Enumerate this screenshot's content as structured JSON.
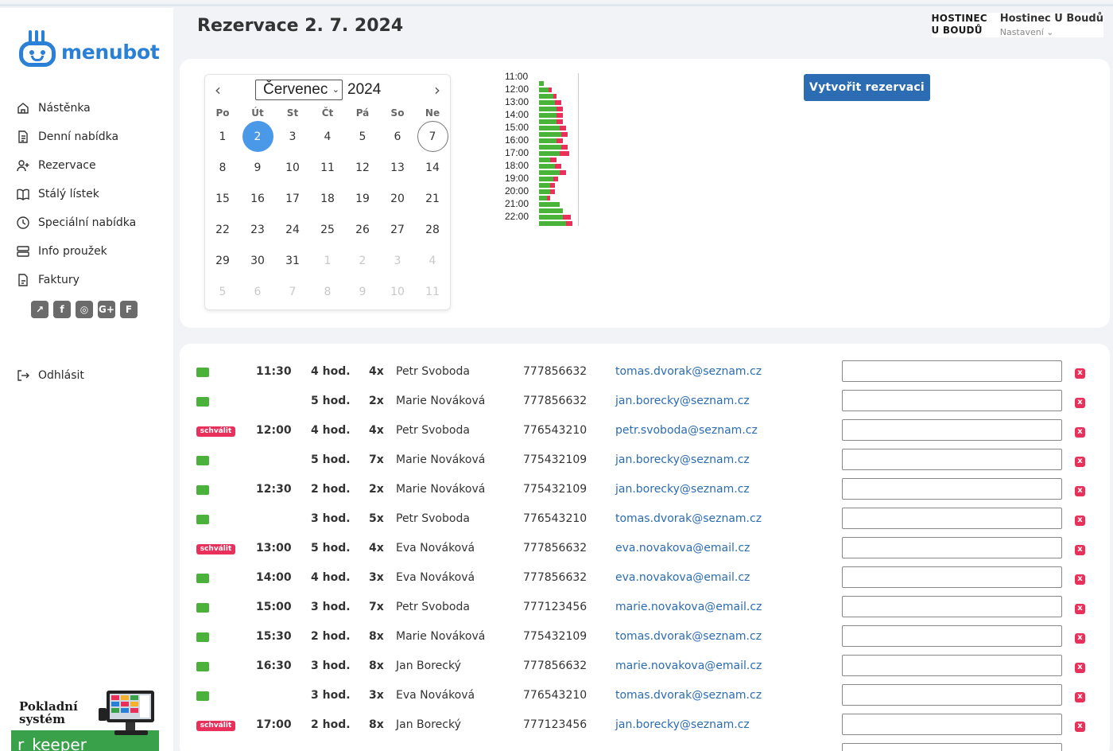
{
  "app": {
    "logo_text": "menubot"
  },
  "header": {
    "title": "Rezervace 2. 7. 2024",
    "restaurant_logo_line1": "HOSTINEC",
    "restaurant_logo_line2": "U BOUDŮ",
    "restaurant_name": "Hostinec U Boudů",
    "settings_label": "Nastavení"
  },
  "sidebar": {
    "items": [
      {
        "label": "Nástěnka",
        "icon": "home-icon"
      },
      {
        "label": "Denní nabídka",
        "icon": "document-icon"
      },
      {
        "label": "Rezervace",
        "icon": "add-user-icon"
      },
      {
        "label": "Stálý lístek",
        "icon": "book-icon"
      },
      {
        "label": "Speciální nabídka",
        "icon": "clock-icon"
      },
      {
        "label": "Info proužek",
        "icon": "strip-icon"
      },
      {
        "label": "Faktury",
        "icon": "invoice-icon"
      }
    ],
    "social": [
      {
        "icon": "external-link-icon",
        "glyph": "↗"
      },
      {
        "icon": "facebook-icon",
        "glyph": "f"
      },
      {
        "icon": "instagram-icon",
        "glyph": "◎"
      },
      {
        "icon": "google-plus-icon",
        "glyph": "G+"
      },
      {
        "icon": "foursquare-icon",
        "glyph": "F"
      }
    ],
    "logout_label": "Odhlásit",
    "promo": {
      "title_line1": "Pokladní",
      "title_line2": "systém",
      "brand": "r_keeper"
    }
  },
  "calendar": {
    "month": "Červenec",
    "year": "2024",
    "weekdays": [
      "Po",
      "Út",
      "St",
      "Čt",
      "Pá",
      "So",
      "Ne"
    ],
    "days": [
      {
        "d": "1",
        "m": false
      },
      {
        "d": "2",
        "m": false,
        "sel": true
      },
      {
        "d": "3",
        "m": false
      },
      {
        "d": "4",
        "m": false
      },
      {
        "d": "5",
        "m": false
      },
      {
        "d": "6",
        "m": false
      },
      {
        "d": "7",
        "m": false,
        "today": true
      },
      {
        "d": "8",
        "m": false
      },
      {
        "d": "9",
        "m": false
      },
      {
        "d": "10",
        "m": false
      },
      {
        "d": "11",
        "m": false
      },
      {
        "d": "12",
        "m": false
      },
      {
        "d": "13",
        "m": false
      },
      {
        "d": "14",
        "m": false
      },
      {
        "d": "15",
        "m": false
      },
      {
        "d": "16",
        "m": false
      },
      {
        "d": "17",
        "m": false
      },
      {
        "d": "18",
        "m": false
      },
      {
        "d": "19",
        "m": false
      },
      {
        "d": "20",
        "m": false
      },
      {
        "d": "21",
        "m": false
      },
      {
        "d": "22",
        "m": false
      },
      {
        "d": "23",
        "m": false
      },
      {
        "d": "24",
        "m": false
      },
      {
        "d": "25",
        "m": false
      },
      {
        "d": "26",
        "m": false
      },
      {
        "d": "27",
        "m": false
      },
      {
        "d": "28",
        "m": false
      },
      {
        "d": "29",
        "m": false
      },
      {
        "d": "30",
        "m": false
      },
      {
        "d": "31",
        "m": false
      },
      {
        "d": "1",
        "m": true
      },
      {
        "d": "2",
        "m": true
      },
      {
        "d": "3",
        "m": true
      },
      {
        "d": "4",
        "m": true
      },
      {
        "d": "5",
        "m": true
      },
      {
        "d": "6",
        "m": true
      },
      {
        "d": "7",
        "m": true
      },
      {
        "d": "8",
        "m": true
      },
      {
        "d": "9",
        "m": true
      },
      {
        "d": "10",
        "m": true
      },
      {
        "d": "11",
        "m": true
      }
    ]
  },
  "occupancy": {
    "hour_labels": [
      "11:00",
      "12:00",
      "13:00",
      "14:00",
      "15:00",
      "16:00",
      "17:00",
      "18:00",
      "19:00",
      "20:00",
      "21:00",
      "22:00"
    ],
    "slots": [
      {
        "g": 6,
        "r": 0
      },
      {
        "g": 12,
        "r": 4
      },
      {
        "g": 18,
        "r": 4
      },
      {
        "g": 20,
        "r": 8
      },
      {
        "g": 22,
        "r": 8
      },
      {
        "g": 22,
        "r": 8
      },
      {
        "g": 22,
        "r": 8
      },
      {
        "g": 26,
        "r": 8
      },
      {
        "g": 28,
        "r": 8
      },
      {
        "g": 22,
        "r": 8
      },
      {
        "g": 28,
        "r": 8
      },
      {
        "g": 26,
        "r": 12
      },
      {
        "g": 14,
        "r": 8
      },
      {
        "g": 20,
        "r": 8
      },
      {
        "g": 26,
        "r": 8
      },
      {
        "g": 18,
        "r": 6
      },
      {
        "g": 14,
        "r": 6
      },
      {
        "g": 14,
        "r": 6
      },
      {
        "g": 10,
        "r": 4
      },
      {
        "g": 26,
        "r": 0
      },
      {
        "g": 30,
        "r": 0
      },
      {
        "g": 30,
        "r": 10
      },
      {
        "g": 34,
        "r": 8
      }
    ],
    "colors": {
      "free": "#49b33a",
      "booked": "#e8305a"
    }
  },
  "actions": {
    "create_label": "Vytvořit rezervaci"
  },
  "reservations": [
    {
      "status": "ok",
      "time": "11:30",
      "duration": "4 hod.",
      "count": "4x",
      "name": "Petr Svoboda",
      "phone": "777856632",
      "email": "tomas.dvorak@seznam.cz"
    },
    {
      "status": "ok",
      "time": "",
      "duration": "5 hod.",
      "count": "2x",
      "name": "Marie Nováková",
      "phone": "777856632",
      "email": "jan.borecky@seznam.cz"
    },
    {
      "status": "pending",
      "time": "12:00",
      "duration": "4 hod.",
      "count": "4x",
      "name": "Petr Svoboda",
      "phone": "776543210",
      "email": "petr.svoboda@seznam.cz"
    },
    {
      "status": "ok",
      "time": "",
      "duration": "5 hod.",
      "count": "7x",
      "name": "Marie Nováková",
      "phone": "775432109",
      "email": "jan.borecky@seznam.cz"
    },
    {
      "status": "ok",
      "time": "12:30",
      "duration": "2 hod.",
      "count": "2x",
      "name": "Marie Nováková",
      "phone": "775432109",
      "email": "jan.borecky@seznam.cz"
    },
    {
      "status": "ok",
      "time": "",
      "duration": "3 hod.",
      "count": "5x",
      "name": "Petr Svoboda",
      "phone": "776543210",
      "email": "tomas.dvorak@seznam.cz"
    },
    {
      "status": "pending",
      "time": "13:00",
      "duration": "5 hod.",
      "count": "4x",
      "name": "Eva Nováková",
      "phone": "777856632",
      "email": "eva.novakova@email.cz"
    },
    {
      "status": "ok",
      "time": "14:00",
      "duration": "4 hod.",
      "count": "3x",
      "name": "Eva Nováková",
      "phone": "777856632",
      "email": "eva.novakova@email.cz"
    },
    {
      "status": "ok",
      "time": "15:00",
      "duration": "3 hod.",
      "count": "7x",
      "name": "Petr Svoboda",
      "phone": "777123456",
      "email": "marie.novakova@email.cz"
    },
    {
      "status": "ok",
      "time": "15:30",
      "duration": "2 hod.",
      "count": "8x",
      "name": "Marie Nováková",
      "phone": "775432109",
      "email": "tomas.dvorak@seznam.cz"
    },
    {
      "status": "ok",
      "time": "16:30",
      "duration": "3 hod.",
      "count": "8x",
      "name": "Jan Borecký",
      "phone": "777856632",
      "email": "marie.novakova@email.cz"
    },
    {
      "status": "ok",
      "time": "",
      "duration": "3 hod.",
      "count": "3x",
      "name": "Eva Nováková",
      "phone": "776543210",
      "email": "tomas.dvorak@seznam.cz"
    },
    {
      "status": "pending",
      "time": "17:00",
      "duration": "2 hod.",
      "count": "8x",
      "name": "Jan Borecký",
      "phone": "777123456",
      "email": "jan.borecky@seznam.cz"
    }
  ],
  "row_labels": {
    "approve": "schválit",
    "delete": "x"
  }
}
